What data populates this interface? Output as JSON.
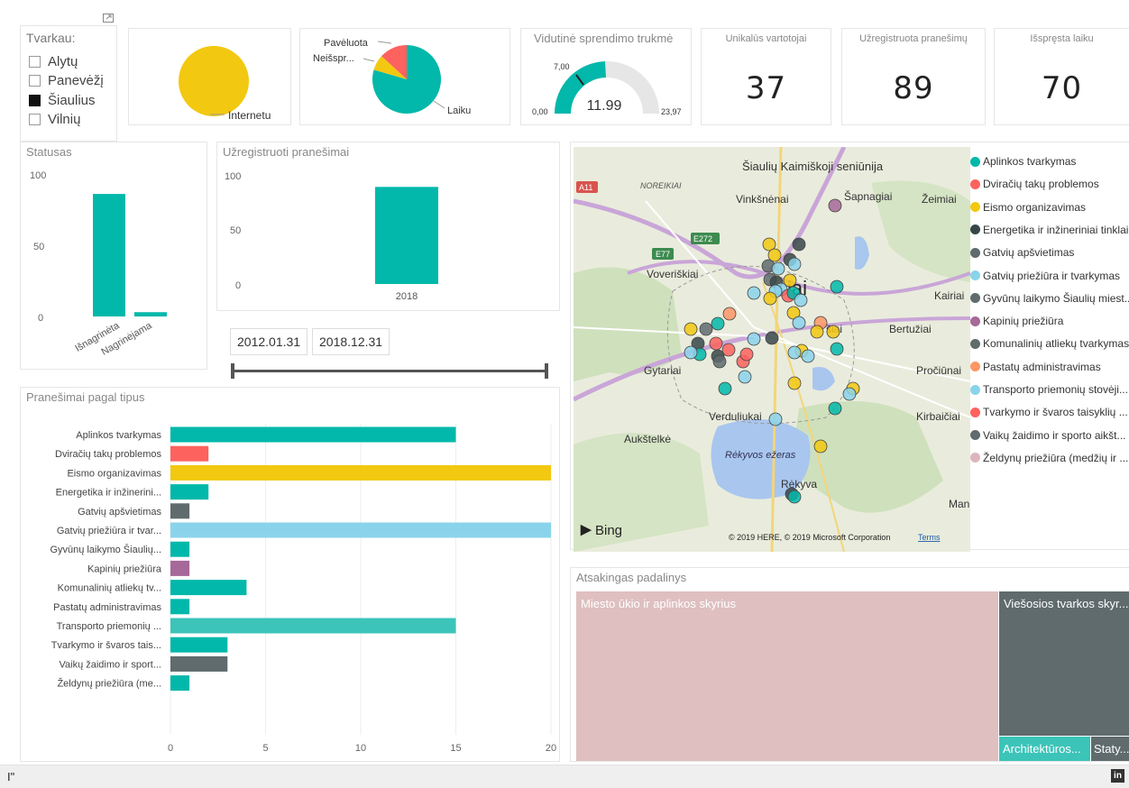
{
  "slicer": {
    "title": "Tvarkau:",
    "items": [
      {
        "label": "Alytų",
        "checked": false
      },
      {
        "label": "Panevėžį",
        "checked": false
      },
      {
        "label": "Šiaulius",
        "checked": true
      },
      {
        "label": "Vilnių",
        "checked": false
      }
    ]
  },
  "pie1": {
    "label": "Internetu",
    "color": "#f2c811"
  },
  "pie2": {
    "slices": [
      {
        "label": "Laiku",
        "color": "#01b8aa"
      },
      {
        "label": "Pavėluota",
        "color": "#fd625e"
      },
      {
        "label": "Neišspr...",
        "color": "#f2c811"
      }
    ]
  },
  "gauge": {
    "title": "Vidutinė sprendimo trukmė",
    "value": "11.99",
    "min": "0,00",
    "max": "23,97",
    "target": "7,00",
    "fill_color": "#01b8aa"
  },
  "kpis": [
    {
      "title": "Unikalūs vartotojai",
      "value": "37"
    },
    {
      "title": "Užregistruota pranešimų",
      "value": "89"
    },
    {
      "title": "Išspręsta laiku",
      "value": "70"
    }
  ],
  "status_chart": {
    "title": "Statusas",
    "chart_data": {
      "type": "bar",
      "categories": [
        "Išnagrinėta",
        "Nagrinėjama"
      ],
      "values": [
        86,
        3
      ],
      "ylim": [
        0,
        100
      ],
      "yticks": [
        "100",
        "50",
        "0"
      ]
    }
  },
  "registered_chart": {
    "title": "Užregistruoti pranešimai",
    "chart_data": {
      "type": "bar",
      "categories": [
        "2018"
      ],
      "values": [
        89
      ],
      "ylim": [
        0,
        100
      ],
      "yticks": [
        "100",
        "50",
        "0"
      ]
    }
  },
  "date_range": {
    "start": "2012.01.31",
    "end": "2018.12.31"
  },
  "types_chart": {
    "title": "Pranešimai pagal tipus",
    "chart_data": {
      "type": "bar",
      "orientation": "horizontal",
      "categories": [
        "Aplinkos tvarkymas",
        "Dviračių takų problemos",
        "Eismo organizavimas",
        "Energetika ir inžinerini...",
        "Gatvių apšvietimas",
        "Gatvių priežiūra ir tvar...",
        "Gyvūnų laikymo Šiaulių...",
        "Kapinių priežiūra",
        "Komunalinių atliekų tv...",
        "Pastatų administravimas",
        "Transporto priemonių ...",
        "Tvarkymo ir švaros tais...",
        "Vaikų žaidimo ir sport...",
        "Želdynų priežiūra (me..."
      ],
      "values": [
        15,
        2,
        20,
        2,
        1,
        20,
        1,
        1,
        4,
        1,
        15,
        3,
        3,
        1
      ],
      "colors": [
        "#01b8aa",
        "#fd625e",
        "#f2c811",
        "#01b8aa",
        "#5f6b6d",
        "#8ad4eb",
        "#01b8aa",
        "#a66999",
        "#01b8aa",
        "#01b8aa",
        "#3cc4b9",
        "#01b8aa",
        "#5f6b6d",
        "#01b8aa"
      ],
      "xlim": [
        0,
        20
      ],
      "xticks": [
        "0",
        "5",
        "10",
        "15",
        "20"
      ]
    }
  },
  "map": {
    "places": [
      "Šiaulių Kaimiškoji seniūnija",
      "NOREIKIAI",
      "Vinkšnėnai",
      "Šapnagiai",
      "Žeimiai",
      "Voveriškiai",
      "iai",
      "Kairiai",
      "šiai",
      "Bertužiai",
      "Gytariai",
      "Pročiūnai",
      "Verduliukai",
      "Kirbaičiai",
      "Aukštelkė",
      "Rėkyvos ežeras",
      "Rėkyva",
      "Man"
    ],
    "roads": [
      "A11",
      "E77",
      "E272"
    ],
    "bing": "Bing",
    "copyright": "© 2019 HERE, © 2019 Microsoft Corporation",
    "terms": "Terms",
    "legend": [
      {
        "label": "Aplinkos tvarkymas",
        "color": "#01b8aa"
      },
      {
        "label": "Dviračių takų problemos",
        "color": "#fd625e"
      },
      {
        "label": "Eismo organizavimas",
        "color": "#f2c811"
      },
      {
        "label": "Energetika ir inžineriniai tinklai",
        "color": "#374649"
      },
      {
        "label": "Gatvių apšvietimas",
        "color": "#5f6b6d"
      },
      {
        "label": "Gatvių priežiūra ir tvarkymas",
        "color": "#8ad4eb"
      },
      {
        "label": "Gyvūnų laikymo Šiaulių miest...",
        "color": "#5f6b6d"
      },
      {
        "label": "Kapinių priežiūra",
        "color": "#a66999"
      },
      {
        "label": "Komunalinių atliekų tvarkymas",
        "color": "#5f6b6d"
      },
      {
        "label": "Pastatų administravimas",
        "color": "#fe9666"
      },
      {
        "label": "Transporto priemonių stovėji...",
        "color": "#8ad4eb"
      },
      {
        "label": "Tvarkymo ir švaros taisyklių ...",
        "color": "#fd625e"
      },
      {
        "label": "Vaikų žaidimo ir sporto aikšt...",
        "color": "#5f6b6d"
      },
      {
        "label": "Želdynų priežiūra (medžių ir ...",
        "color": "#dcb6bb"
      }
    ]
  },
  "treemap": {
    "title": "Atsakingas padalinys",
    "items": [
      {
        "label": "Miesto ūkio ir aplinkos skyrius",
        "color": "#dfbfbf"
      },
      {
        "label": "Viešosios tvarkos skyr...",
        "color": "#5f6b6d"
      },
      {
        "label": "Architektūros...",
        "color": "#3cc4b9"
      },
      {
        "label": "Staty...",
        "color": "#5f6b6d"
      }
    ]
  },
  "footer": {
    "left": "I\"",
    "right": "in"
  }
}
